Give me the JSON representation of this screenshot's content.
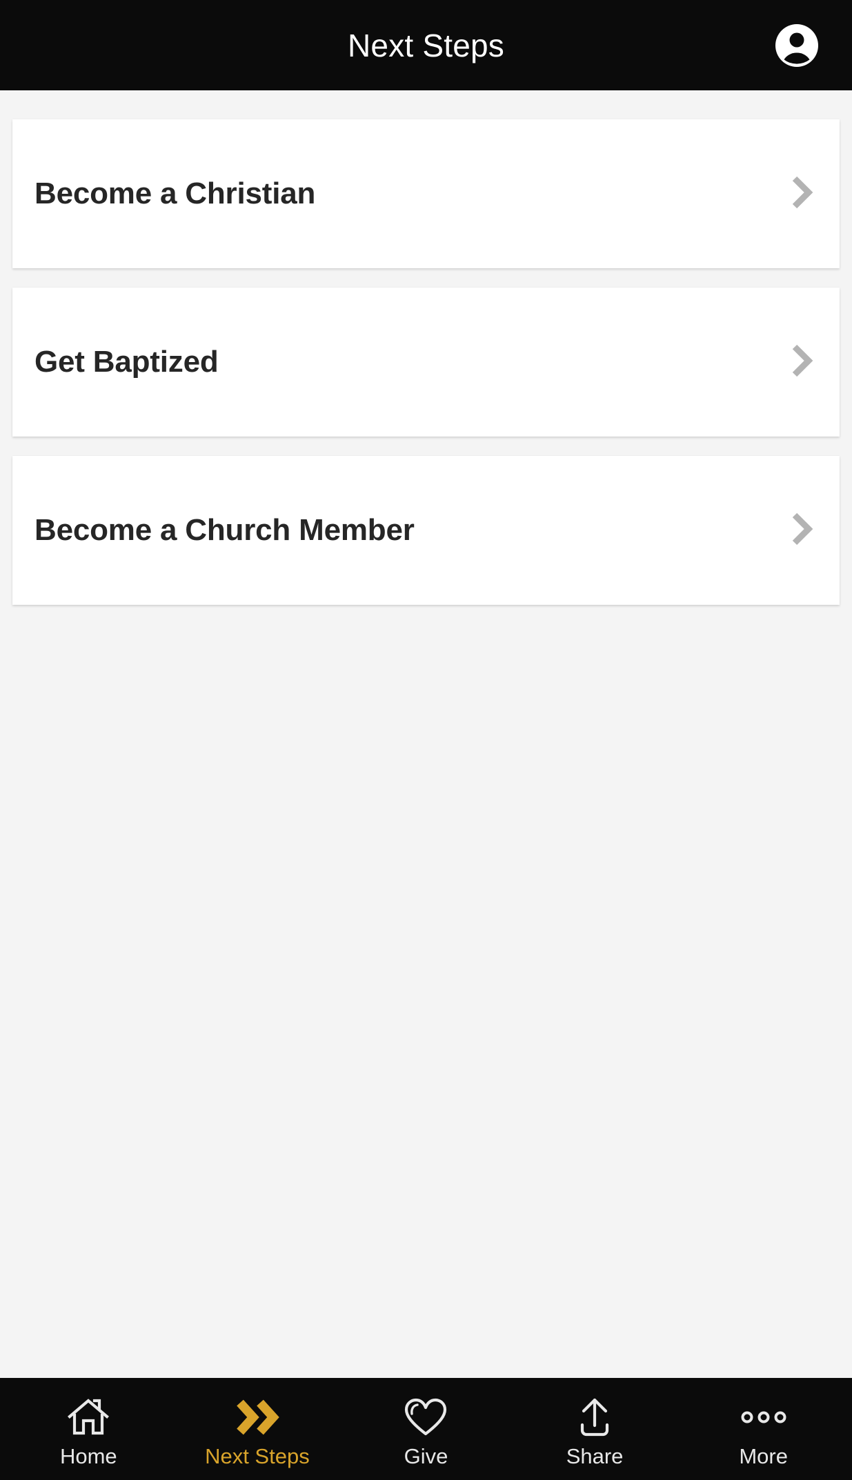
{
  "header": {
    "title": "Next Steps",
    "avatar_icon": "account-circle-icon"
  },
  "theme": {
    "header_background": "#0b0b0b",
    "page_background": "#f4f4f4",
    "card_background": "#ffffff",
    "card_text": "#262626",
    "chevron_color": "#b3b3b3",
    "nav_background": "#0b0b0b",
    "nav_inactive_text": "#e8e8e8",
    "accent_gold": "#d9a42b"
  },
  "main": {
    "steps": [
      {
        "label": "Become a Christian",
        "chevron_icon": "chevron-right-icon"
      },
      {
        "label": "Get Baptized",
        "chevron_icon": "chevron-right-icon"
      },
      {
        "label": "Become a Church Member",
        "chevron_icon": "chevron-right-icon"
      }
    ]
  },
  "bottom_nav": {
    "items": [
      {
        "label": "Home",
        "icon": "home-icon",
        "active": false
      },
      {
        "label": "Next Steps",
        "icon": "double-chevron-icon",
        "active": true
      },
      {
        "label": "Give",
        "icon": "heart-icon",
        "active": false
      },
      {
        "label": "Share",
        "icon": "share-upload-icon",
        "active": false
      },
      {
        "label": "More",
        "icon": "more-dots-icon",
        "active": false
      }
    ]
  }
}
